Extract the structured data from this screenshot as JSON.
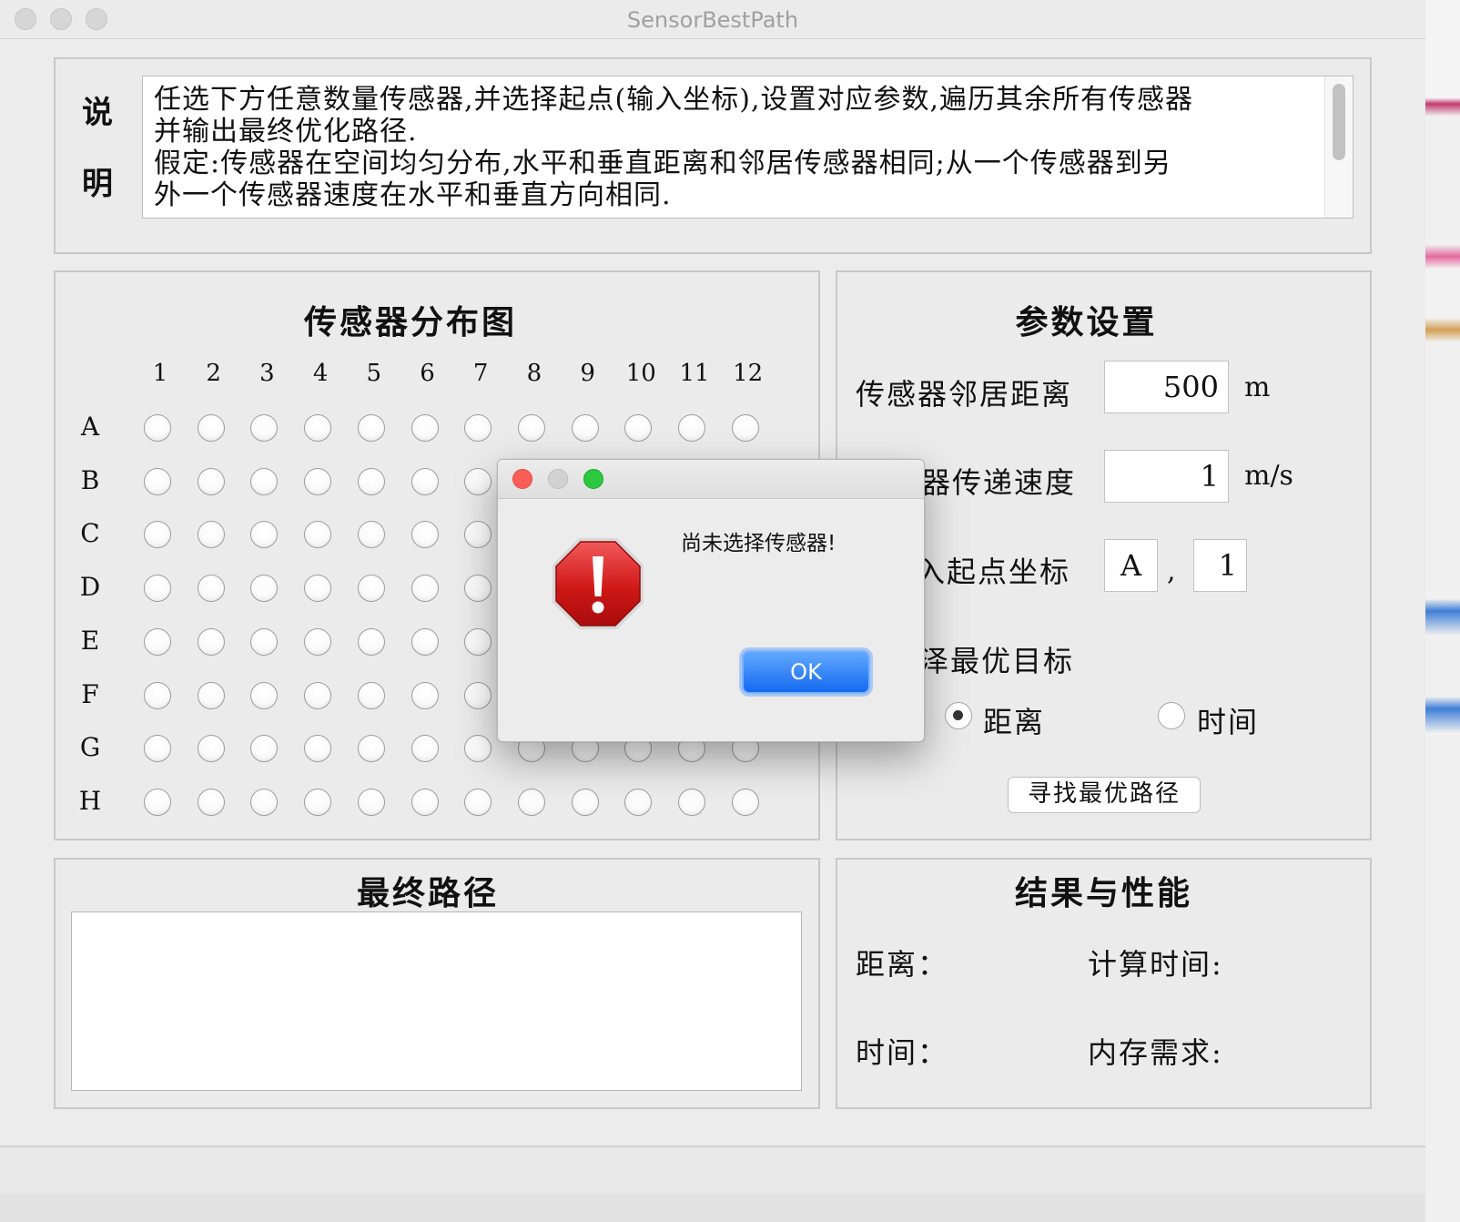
{
  "window": {
    "title": "SensorBestPath"
  },
  "description": {
    "label_line1": "说",
    "label_line2": "明",
    "lines": [
      "任选下方任意数量传感器,并选择起点(输入坐标),设置对应参数,遍历其余所有传感器",
      "并输出最终优化路径.",
      "假定:传感器在空间均匀分布,水平和垂直距离和邻居传感器相同;从一个传感器到另",
      "外一个传感器速度在水平和垂直方向相同."
    ]
  },
  "sensor_map": {
    "title": "传感器分布图",
    "columns": [
      "1",
      "2",
      "3",
      "4",
      "5",
      "6",
      "7",
      "8",
      "9",
      "10",
      "11",
      "12"
    ],
    "rows": [
      "A",
      "B",
      "C",
      "D",
      "E",
      "F",
      "G",
      "H"
    ]
  },
  "params": {
    "title": "参数设置",
    "neighbor_distance_label": "传感器邻居距离",
    "neighbor_distance_value": "500",
    "neighbor_distance_unit": "m",
    "speed_label": "器传递速度",
    "speed_value": "1",
    "speed_unit": "m/s",
    "start_label": "入起点坐标",
    "start_row_value": "A",
    "start_sep": ",",
    "start_col_value": "1",
    "objective_label": "泽最优目标",
    "option_distance": "距离",
    "option_time": "时间",
    "selected_option": "distance",
    "find_button": "寻找最优路径"
  },
  "final_path": {
    "title": "最终路径",
    "value": ""
  },
  "results": {
    "title": "结果与性能",
    "distance_label": "距离：",
    "compute_time_label": "计算时间:",
    "time_label": "时间：",
    "memory_label": "内存需求:"
  },
  "dialog": {
    "message": "尚未选择传感器!",
    "ok_label": "OK",
    "icon": "stop-warning-icon"
  }
}
